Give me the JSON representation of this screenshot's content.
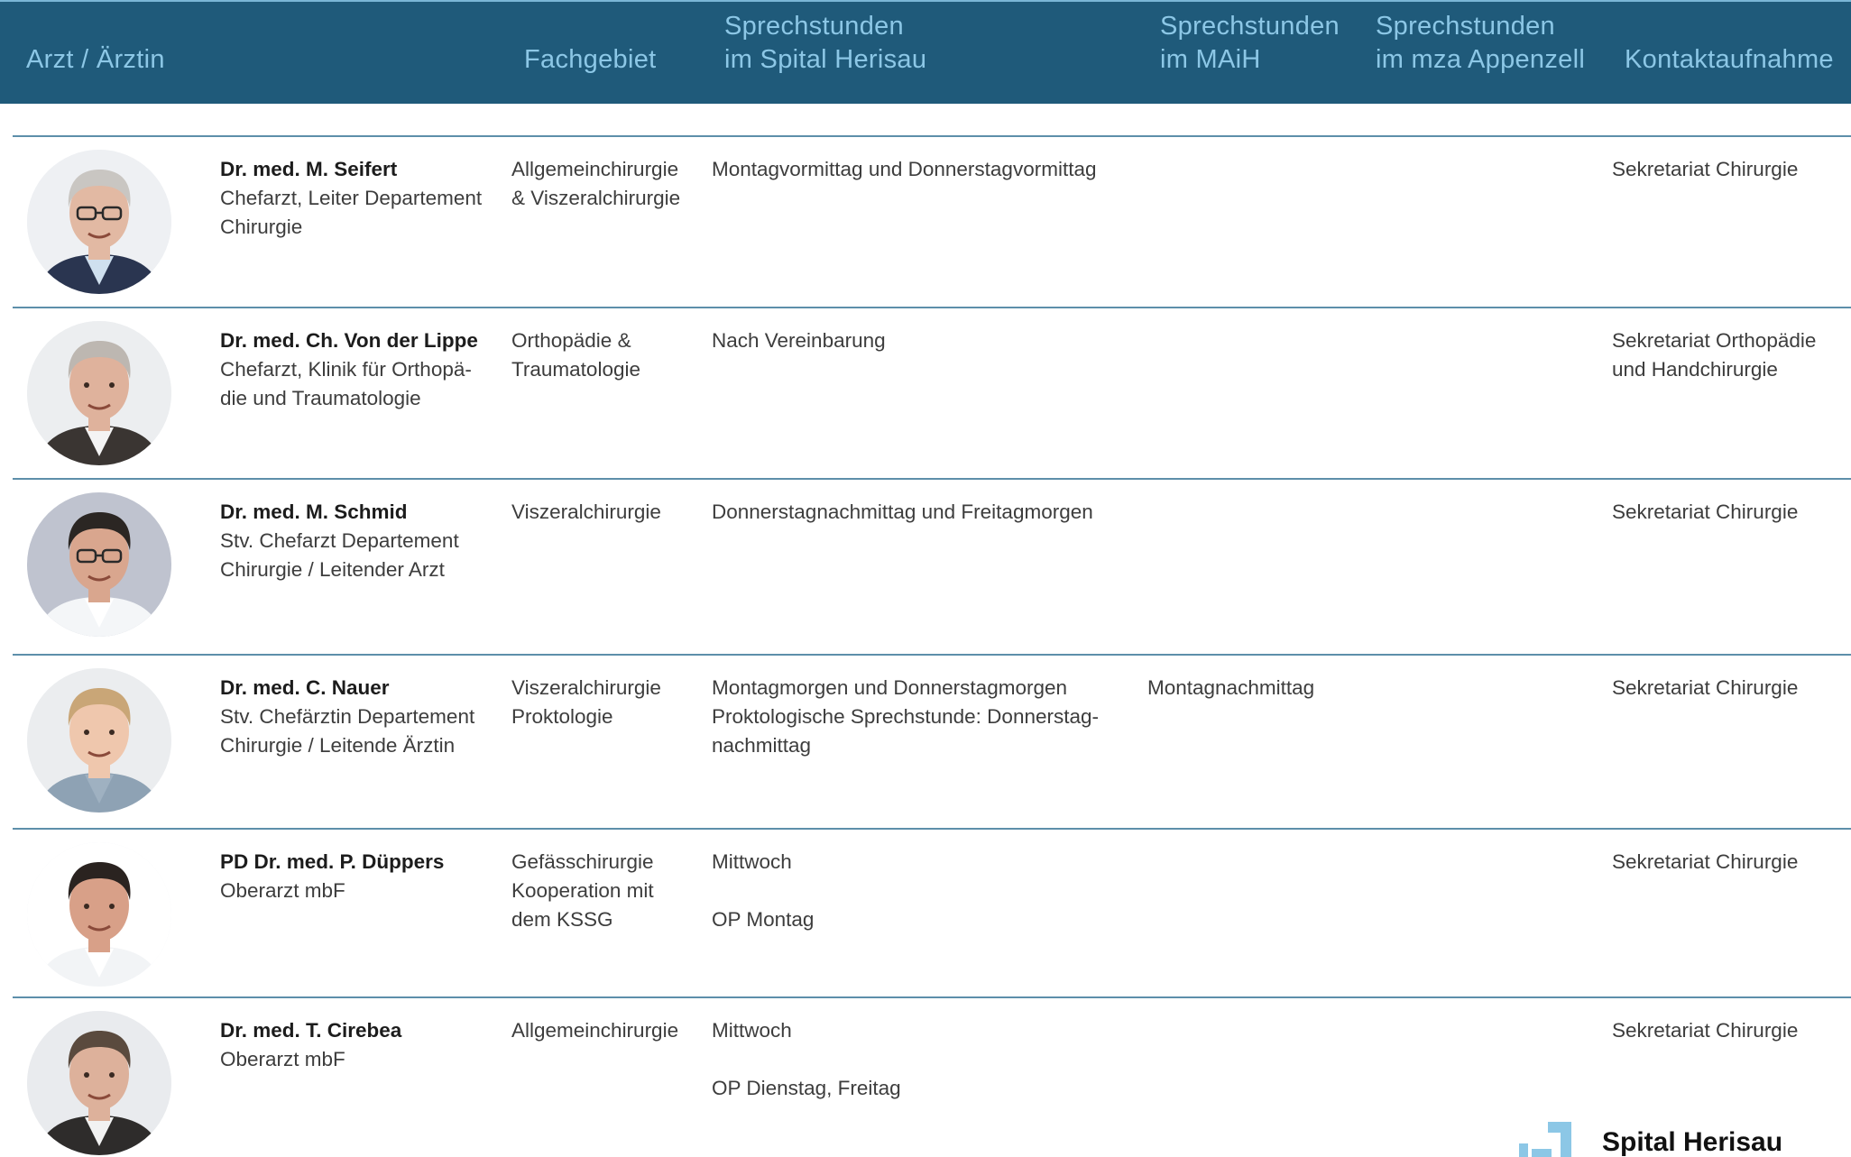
{
  "header": {
    "col_arzt": "Arzt / Ärztin",
    "col_fachgebiet": "Fachgebiet",
    "col_herisau": [
      "Sprechstunden",
      "im Spital Herisau"
    ],
    "col_maih": [
      "Sprechstunden",
      "im MAiH"
    ],
    "col_appenzell": [
      "Sprechstunden",
      "im mza Appenzell"
    ],
    "col_kontakt": "Kontaktaufnahme"
  },
  "doctors": [
    {
      "name": "Dr. med. M. Seifert",
      "role": [
        "Chefarzt, Leiter Departement",
        "Chirurgie"
      ],
      "fachgebiet": [
        "Allgemeinchirurgie",
        "& Viszeralchirurgie"
      ],
      "herisau": [
        "Montagvormittag und Donnerstagvormittag"
      ],
      "maih": [],
      "appenzell": [],
      "kontakt": [
        "Sekretariat Chirurgie"
      ],
      "portrait": {
        "bg": "#eef0f3",
        "hair": "#c9c6c2",
        "skin": "#e2b9a3",
        "suit": "#2a3550",
        "shirt": "#cfe0ef",
        "glasses": true
      }
    },
    {
      "name": "Dr. med. Ch. Von der Lippe",
      "role": [
        "Chefarzt, Klinik für Orthopä-",
        "die und Traumatologie"
      ],
      "fachgebiet": [
        "Orthopädie &",
        "Traumatologie"
      ],
      "herisau": [
        "Nach Vereinbarung"
      ],
      "maih": [],
      "appenzell": [],
      "kontakt": [
        "Sekretariat Orthopädie",
        "und Handchirurgie"
      ],
      "portrait": {
        "bg": "#eceef0",
        "hair": "#bdb7b1",
        "skin": "#dfb29c",
        "suit": "#3a3532",
        "shirt": "#f4f4f4",
        "glasses": false
      }
    },
    {
      "name": "Dr. med. M. Schmid",
      "role": [
        "Stv. Chefarzt Departement",
        "Chirurgie / Leitender Arzt"
      ],
      "fachgebiet": [
        "Viszeralchirurgie"
      ],
      "herisau": [
        "Donnerstagnachmittag und Freitagmorgen"
      ],
      "maih": [],
      "appenzell": [],
      "kontakt": [
        "Sekretariat Chirurgie"
      ],
      "portrait": {
        "bg": "#bfc3cf",
        "hair": "#2b2623",
        "skin": "#d9a68e",
        "suit": "#f4f6f8",
        "shirt": "#ffffff",
        "glasses": true
      }
    },
    {
      "name": "Dr. med. C. Nauer",
      "role": [
        "Stv. Chefärztin Departement",
        "Chirurgie / Leitende Ärztin"
      ],
      "fachgebiet": [
        "Viszeralchirurgie",
        "Proktologie"
      ],
      "herisau": [
        "Montagmorgen und Donnerstagmorgen",
        "Proktologische Sprechstunde: Donnerstag-",
        "nachmittag"
      ],
      "maih": [
        "Montagnachmittag"
      ],
      "appenzell": [],
      "kontakt": [
        "Sekretariat Chirurgie"
      ],
      "portrait": {
        "bg": "#ebedef",
        "hair": "#c9a677",
        "skin": "#efc7ad",
        "suit": "#8ea2b4",
        "shirt": "#9fb1c1",
        "glasses": false
      }
    },
    {
      "name": "PD Dr. med. P. Düppers",
      "role": [
        "Oberarzt mbF"
      ],
      "fachgebiet": [
        "Gefässchirurgie",
        "Kooperation mit",
        "dem KSSG"
      ],
      "herisau": [
        "Mittwoch",
        "",
        "OP Montag"
      ],
      "maih": [],
      "appenzell": [],
      "kontakt": [
        "Sekretariat Chirurgie"
      ],
      "portrait": {
        "bg": "#ffffff",
        "hair": "#2a2320",
        "skin": "#d8a088",
        "suit": "#f2f4f6",
        "shirt": "#ffffff",
        "glasses": false
      }
    },
    {
      "name": "Dr. med. T. Cirebea",
      "role": [
        "Oberarzt mbF"
      ],
      "fachgebiet": [
        "Allgemeinchirurgie"
      ],
      "herisau": [
        "Mittwoch",
        "",
        "OP Dienstag, Freitag"
      ],
      "maih": [],
      "appenzell": [],
      "kontakt": [
        "Sekretariat Chirurgie"
      ],
      "portrait": {
        "bg": "#e9ebee",
        "hair": "#5a4a3e",
        "skin": "#ddb19b",
        "suit": "#2e2c2b",
        "shirt": "#f2f2f2",
        "glasses": false
      }
    }
  ],
  "logo": {
    "text": "Spital Herisau",
    "color": "#8cc7e6"
  }
}
